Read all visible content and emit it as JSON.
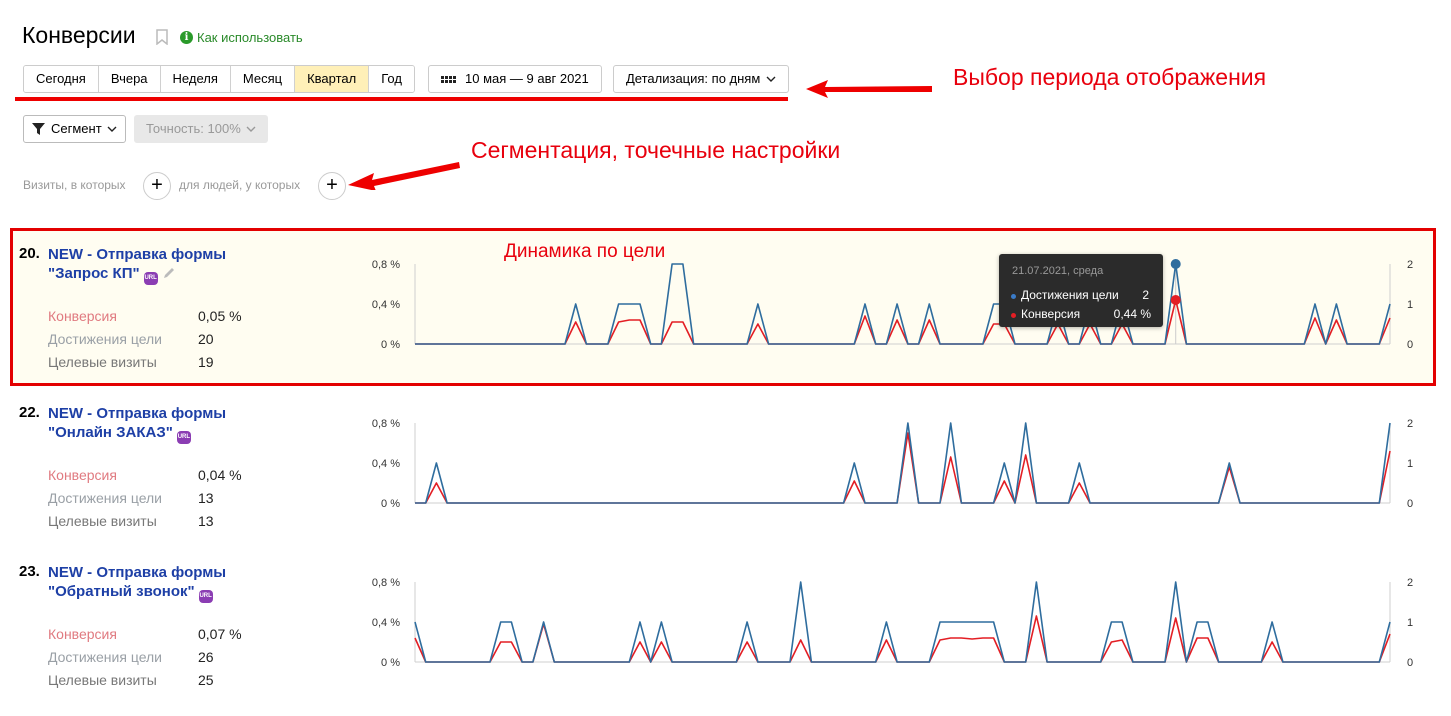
{
  "header": {
    "title": "Конверсии",
    "howto": "Как использовать"
  },
  "period": {
    "buttons": [
      "Сегодня",
      "Вчера",
      "Неделя",
      "Месяц",
      "Квартал",
      "Год"
    ],
    "active": "Квартал",
    "date_range": "10 мая — 9 авг 2021",
    "detail": "Детализация: по дням"
  },
  "segment": {
    "label": "Сегмент",
    "precision": "Точность: 100%"
  },
  "filters": {
    "visits": "Визиты, в которых",
    "people": "для людей, у которых"
  },
  "annotations": {
    "period": "Выбор периода отображения",
    "segmentation": "Сегментация, точечные  настройки",
    "dynamics": "Динамика по цели"
  },
  "colors": {
    "achievements": "#2f6d9e",
    "conversion": "#e31e24",
    "link": "#1d3fa6",
    "highlight": "#fffdf1",
    "annotation": "#e8000d"
  },
  "goals": [
    {
      "num": "20.",
      "name_line1": "NEW - Отправка формы",
      "name_line2": "\"Запрос КП\"",
      "metrics": [
        {
          "label": "Конверсия",
          "value": "0,05 %"
        },
        {
          "label": "Достижения цели",
          "value": "20"
        },
        {
          "label": "Целевые визиты",
          "value": "19"
        }
      ]
    },
    {
      "num": "22.",
      "name_line1": "NEW - Отправка формы",
      "name_line2": "\"Онлайн ЗАКАЗ\"",
      "metrics": [
        {
          "label": "Конверсия",
          "value": "0,04 %"
        },
        {
          "label": "Достижения цели",
          "value": "13"
        },
        {
          "label": "Целевые визиты",
          "value": "13"
        }
      ]
    },
    {
      "num": "23.",
      "name_line1": "NEW - Отправка формы",
      "name_line2": "\"Обратный звонок\"",
      "metrics": [
        {
          "label": "Конверсия",
          "value": "0,07 %"
        },
        {
          "label": "Достижения цели",
          "value": "26"
        },
        {
          "label": "Целевые визиты",
          "value": "25"
        }
      ]
    }
  ],
  "tooltip": {
    "date": "21.07.2021, среда",
    "rows": [
      {
        "label": "Достижения цели",
        "value": "2"
      },
      {
        "label": "Конверсия",
        "value": "0,44 %"
      }
    ]
  },
  "chart_data": [
    {
      "type": "line",
      "left_ticks": [
        "0,8 %",
        "0,4 %",
        "0 %"
      ],
      "right_ticks": [
        "2",
        "1",
        "0"
      ],
      "ylim_left": [
        0,
        0.8
      ],
      "ylim_right": [
        0,
        2
      ],
      "days": 92,
      "series": [
        {
          "name": "Достижения цели",
          "axis": "right",
          "color": "#2f6d9e",
          "points": [
            [
              15,
              1
            ],
            [
              19,
              1
            ],
            [
              20,
              1
            ],
            [
              21,
              1
            ],
            [
              24,
              2
            ],
            [
              25,
              2
            ],
            [
              32,
              1
            ],
            [
              42,
              1
            ],
            [
              45,
              1
            ],
            [
              48,
              1
            ],
            [
              54,
              1
            ],
            [
              55,
              1
            ],
            [
              60,
              1
            ],
            [
              63,
              1
            ],
            [
              66,
              1
            ],
            [
              71,
              2
            ],
            [
              84,
              1
            ],
            [
              86,
              1
            ],
            [
              91,
              1
            ]
          ]
        },
        {
          "name": "Конверсия",
          "axis": "left",
          "color": "#e31e24",
          "points": [
            [
              15,
              0.22
            ],
            [
              19,
              0.22
            ],
            [
              20,
              0.24
            ],
            [
              21,
              0.24
            ],
            [
              24,
              0.22
            ],
            [
              25,
              0.22
            ],
            [
              32,
              0.2
            ],
            [
              42,
              0.28
            ],
            [
              45,
              0.24
            ],
            [
              48,
              0.24
            ],
            [
              54,
              0.2
            ],
            [
              55,
              0.2
            ],
            [
              60,
              0.2
            ],
            [
              63,
              0.2
            ],
            [
              66,
              0.2
            ],
            [
              71,
              0.44
            ],
            [
              84,
              0.26
            ],
            [
              86,
              0.24
            ],
            [
              91,
              0.26
            ]
          ]
        }
      ],
      "hover_day": 71
    },
    {
      "type": "line",
      "left_ticks": [
        "0,8 %",
        "0,4 %",
        "0 %"
      ],
      "right_ticks": [
        "2",
        "1",
        "0"
      ],
      "ylim_left": [
        0,
        0.8
      ],
      "ylim_right": [
        0,
        2
      ],
      "days": 92,
      "series": [
        {
          "name": "Достижения цели",
          "axis": "right",
          "color": "#2f6d9e",
          "points": [
            [
              2,
              1
            ],
            [
              41,
              1
            ],
            [
              46,
              2
            ],
            [
              50,
              2
            ],
            [
              55,
              1
            ],
            [
              57,
              2
            ],
            [
              62,
              1
            ],
            [
              76,
              1
            ],
            [
              91,
              2
            ]
          ]
        },
        {
          "name": "Конверсия",
          "axis": "left",
          "color": "#e31e24",
          "points": [
            [
              2,
              0.2
            ],
            [
              41,
              0.22
            ],
            [
              46,
              0.7
            ],
            [
              50,
              0.46
            ],
            [
              55,
              0.22
            ],
            [
              57,
              0.48
            ],
            [
              62,
              0.2
            ],
            [
              76,
              0.36
            ],
            [
              91,
              0.52
            ]
          ]
        }
      ]
    },
    {
      "type": "line",
      "left_ticks": [
        "0,8 %",
        "0,4 %",
        "0 %"
      ],
      "right_ticks": [
        "2",
        "1",
        "0"
      ],
      "ylim_left": [
        0,
        0.8
      ],
      "ylim_right": [
        0,
        2
      ],
      "days": 92,
      "series": [
        {
          "name": "Достижения цели",
          "axis": "right",
          "color": "#2f6d9e",
          "points": [
            [
              0,
              1
            ],
            [
              8,
              1
            ],
            [
              9,
              1
            ],
            [
              12,
              1
            ],
            [
              21,
              1
            ],
            [
              23,
              1
            ],
            [
              31,
              1
            ],
            [
              36,
              2
            ],
            [
              44,
              1
            ],
            [
              49,
              1
            ],
            [
              50,
              1
            ],
            [
              51,
              1
            ],
            [
              52,
              1
            ],
            [
              53,
              1
            ],
            [
              54,
              1
            ],
            [
              58,
              2
            ],
            [
              65,
              1
            ],
            [
              66,
              1
            ],
            [
              71,
              2
            ],
            [
              73,
              1
            ],
            [
              74,
              1
            ],
            [
              80,
              1
            ],
            [
              91,
              1
            ]
          ]
        },
        {
          "name": "Конверсия",
          "axis": "left",
          "color": "#e31e24",
          "points": [
            [
              0,
              0.24
            ],
            [
              8,
              0.2
            ],
            [
              9,
              0.2
            ],
            [
              12,
              0.38
            ],
            [
              21,
              0.2
            ],
            [
              23,
              0.2
            ],
            [
              31,
              0.2
            ],
            [
              36,
              0.22
            ],
            [
              44,
              0.22
            ],
            [
              49,
              0.22
            ],
            [
              50,
              0.24
            ],
            [
              51,
              0.24
            ],
            [
              52,
              0.23
            ],
            [
              53,
              0.24
            ],
            [
              54,
              0.24
            ],
            [
              58,
              0.46
            ],
            [
              65,
              0.2
            ],
            [
              66,
              0.22
            ],
            [
              71,
              0.44
            ],
            [
              73,
              0.24
            ],
            [
              74,
              0.24
            ],
            [
              80,
              0.2
            ],
            [
              91,
              0.28
            ]
          ]
        }
      ]
    }
  ]
}
